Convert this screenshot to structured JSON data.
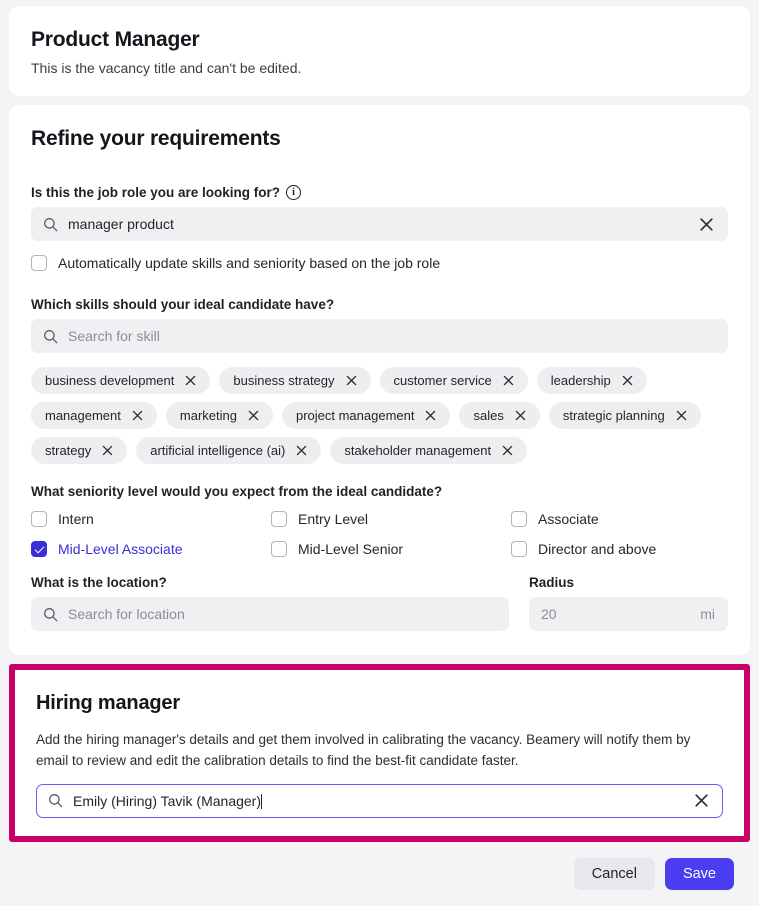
{
  "vacancy": {
    "title": "Product Manager",
    "subtitle": "This is the vacancy title and can't be edited."
  },
  "refine": {
    "title": "Refine your requirements",
    "job_role": {
      "label": "Is this the job role you are looking for?",
      "info_glyph": "i",
      "value": "manager product",
      "clear_label": "clear"
    },
    "auto_update": {
      "label": "Automatically update skills and seniority based on the job role",
      "checked": false
    },
    "skills": {
      "label": "Which skills should your ideal candidate have?",
      "placeholder": "Search for skill",
      "chips": [
        "business development",
        "business strategy",
        "customer service",
        "leadership",
        "management",
        "marketing",
        "project management",
        "sales",
        "strategic planning",
        "strategy",
        "artificial intelligence (ai)",
        "stakeholder management"
      ]
    },
    "seniority": {
      "label": "What seniority level would you expect from the ideal candidate?",
      "options": [
        {
          "label": "Intern",
          "checked": false
        },
        {
          "label": "Entry Level",
          "checked": false
        },
        {
          "label": "Associate",
          "checked": false
        },
        {
          "label": "Mid-Level Associate",
          "checked": true
        },
        {
          "label": "Mid-Level Senior",
          "checked": false
        },
        {
          "label": "Director and above",
          "checked": false
        }
      ]
    },
    "location": {
      "label": "What is the location?",
      "placeholder": "Search for location"
    },
    "radius": {
      "label": "Radius",
      "placeholder": "20",
      "unit": "mi"
    }
  },
  "hiring_manager": {
    "title": "Hiring manager",
    "description": "Add the hiring manager's details and get them involved in calibrating the vacancy. Beamery will notify them by email to review and edit the calibration details to find the best-fit candidate faster.",
    "input_value": "Emily (Hiring) Tavik (Manager)",
    "clear_label": "clear"
  },
  "footer": {
    "cancel_label": "Cancel",
    "save_label": "Save"
  },
  "colors": {
    "page_background": "#F4F4F6",
    "accent_indigo": "#4B3EF0",
    "checkbox_checked": "#3A2FD6",
    "highlight_pink": "#C80069",
    "focus_purple": "#6B5CF0"
  }
}
